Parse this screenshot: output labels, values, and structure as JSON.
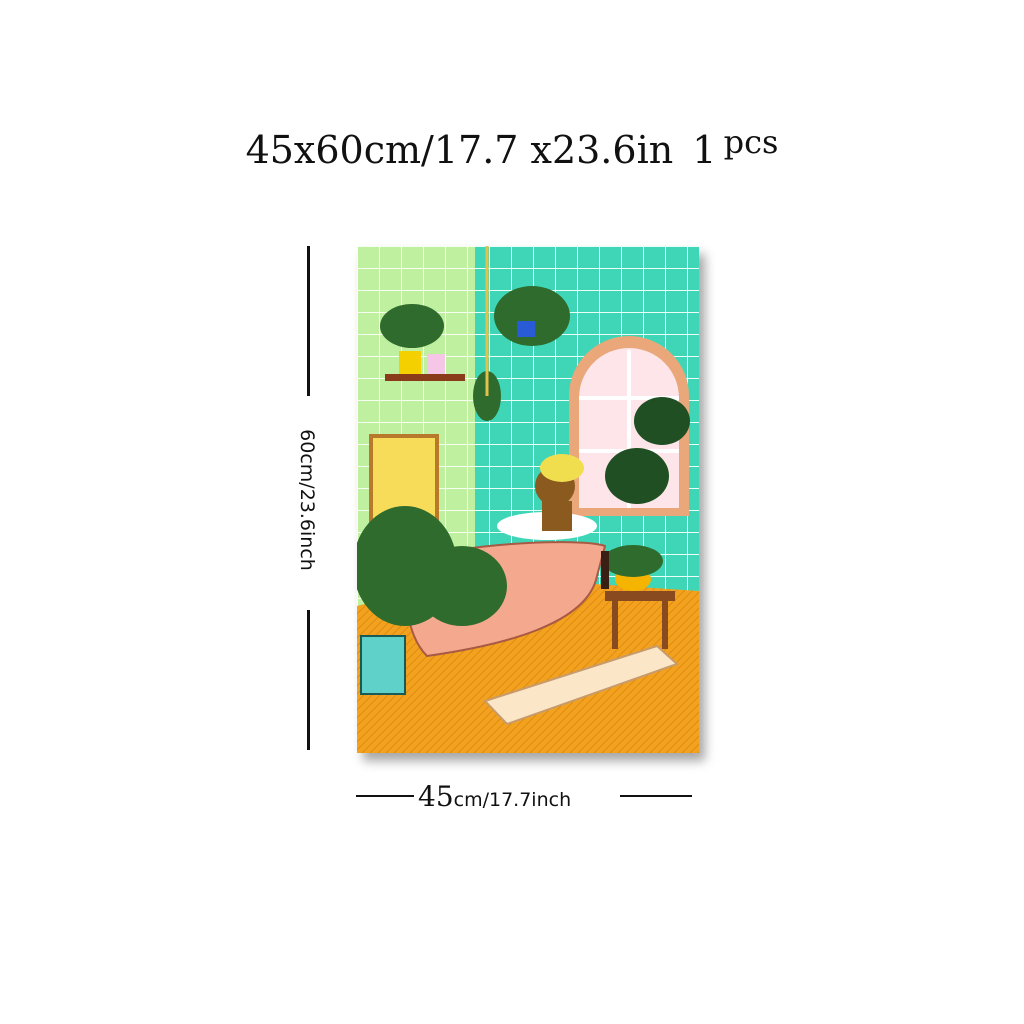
{
  "title": {
    "size_text": "45x60cm/17.7 x23.6in",
    "quantity_number": "1",
    "quantity_unit": "pcs"
  },
  "height_label": "60cm/23.6inch",
  "width_label": {
    "value": "45",
    "unit_text": "cm/17.7inch"
  },
  "artwork": {
    "subject": "woman-in-bathtub-with-plants",
    "colors": {
      "tile": "#3fd6b8",
      "tile_grout": "#e9fff8",
      "wall_light": "#d9f59a",
      "floor": "#f2a21f",
      "tub": "#f4a98f",
      "plant": "#2f6b2c",
      "window_frame": "#e9a77a",
      "rug": "#fbe6c8"
    }
  }
}
